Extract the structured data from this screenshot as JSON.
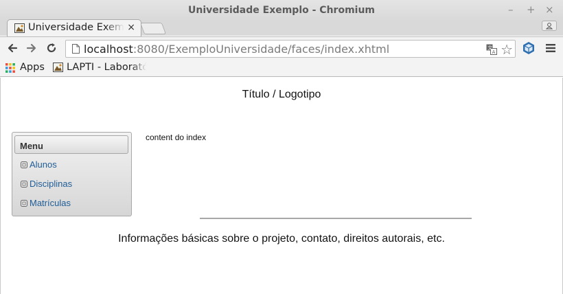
{
  "window": {
    "title": "Universidade Exemplo - Chromium",
    "controls": {
      "minimize": "–",
      "maximize": "+",
      "close": "×"
    }
  },
  "tabs": [
    {
      "title": "Universidade Exemplo - Chromium",
      "close": "×",
      "active": true
    }
  ],
  "toolbar": {
    "url_host": "localhost",
    "url_rest": ":8080/ExemploUniversidade/faces/index.xhtml",
    "star": "☆"
  },
  "bookmarks": {
    "apps_label": "Apps",
    "items": [
      {
        "label": "LAPTI - Laboratório"
      }
    ]
  },
  "page": {
    "header": "Título / Logotipo",
    "menu": {
      "title": "Menu",
      "items": [
        {
          "label": "Alunos"
        },
        {
          "label": "Disciplinas"
        },
        {
          "label": "Matrículas"
        }
      ]
    },
    "content": "content do index",
    "footer": "Informações básicas sobre o projeto, contato, direitos autorais, etc."
  },
  "colors": {
    "link": "#1f5c96",
    "chrome_bg": "#f3f3f3",
    "titlebar_bg": "#d9d9d9"
  }
}
